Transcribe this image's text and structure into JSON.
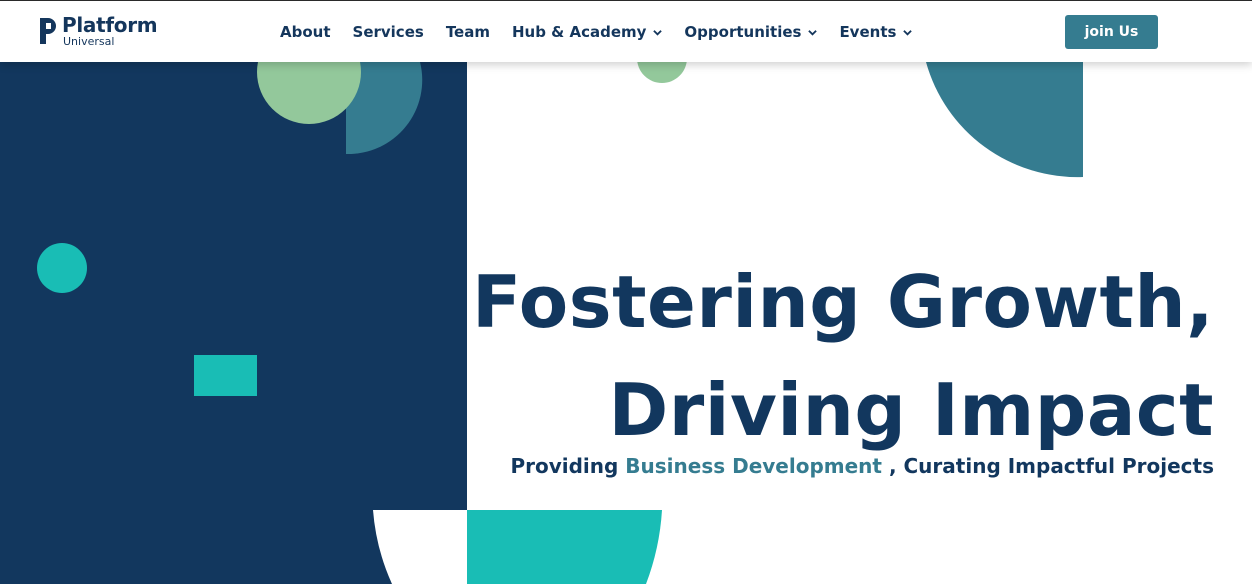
{
  "brand": {
    "name": "Platform",
    "tagline": "Universal"
  },
  "nav": {
    "items": [
      {
        "label": "About",
        "has_dropdown": false
      },
      {
        "label": "Services",
        "has_dropdown": false
      },
      {
        "label": "Team",
        "has_dropdown": false
      },
      {
        "label": "Hub & Academy",
        "has_dropdown": true
      },
      {
        "label": "Opportunities",
        "has_dropdown": true
      },
      {
        "label": "Events",
        "has_dropdown": true
      }
    ],
    "cta_label": "join Us"
  },
  "hero": {
    "title_line1": "Fostering Growth,",
    "title_line2": "Driving Impact",
    "subtitle_prefix": "Providing ",
    "subtitle_highlight": "Business Development",
    "subtitle_suffix": " , Curating Impactful Projects"
  },
  "colors": {
    "navy": "#12375e",
    "teal": "#357c90",
    "turquoise": "#19bdb5",
    "mint": "#93c89b",
    "white": "#ffffff"
  }
}
